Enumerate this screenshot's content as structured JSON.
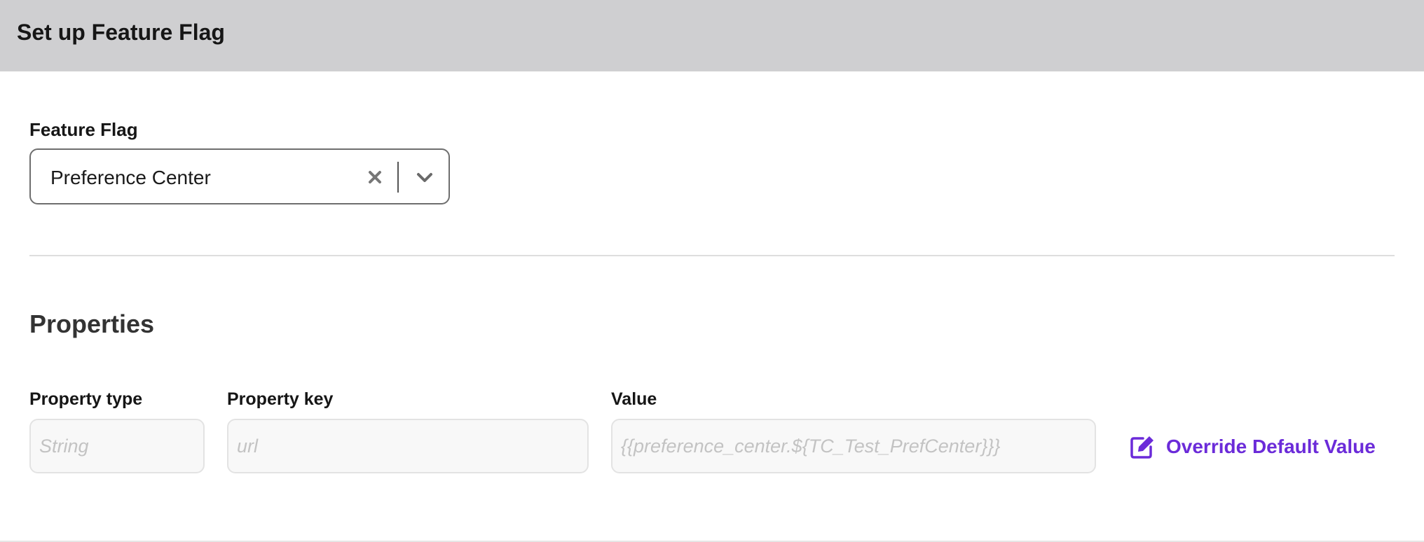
{
  "header": {
    "title": "Set up Feature Flag"
  },
  "feature_flag": {
    "label": "Feature Flag",
    "selected_value": "Preference Center",
    "icons": {
      "clear": "close-icon",
      "expand": "chevron-down-icon"
    }
  },
  "properties": {
    "title": "Properties",
    "property_type": {
      "label": "Property type",
      "placeholder": "String"
    },
    "property_key": {
      "label": "Property key",
      "placeholder": "url"
    },
    "value": {
      "label": "Value",
      "placeholder": "{{preference_center.${TC_Test_PrefCenter}}}"
    },
    "override": {
      "label": "Override Default Value",
      "icon": "edit-icon"
    }
  },
  "colors": {
    "header_bg": "#cfcfd1",
    "accent": "#6b2bd9",
    "input_bg": "#f8f8f8",
    "input_border": "#e3e3e3"
  }
}
